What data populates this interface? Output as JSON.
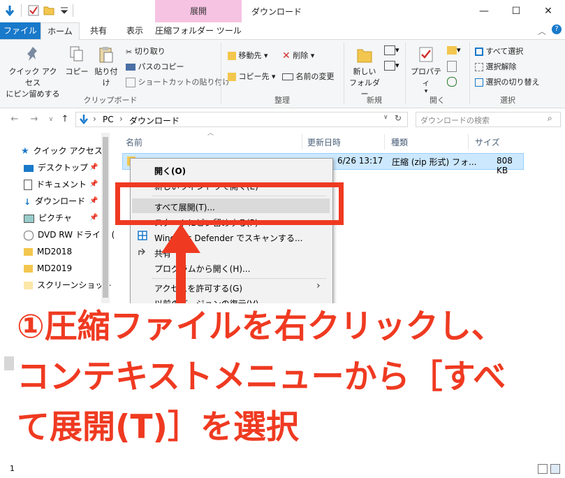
{
  "window": {
    "title": "ダウンロード",
    "context_tab_header": "展開",
    "minimize": "—",
    "maximize": "☐",
    "close": "✕"
  },
  "tabs": [
    "ファイル",
    "ホーム",
    "共有",
    "表示",
    "圧縮フォルダー ツール"
  ],
  "ribbon": {
    "clipboard": {
      "label": "クリップボード",
      "pin_quick_access_line1": "クイック アクセス",
      "pin_quick_access_line2": "にピン留めする",
      "copy": "コピー",
      "paste": "貼り付け",
      "cut": "切り取り",
      "copy_path": "パスのコピー",
      "paste_shortcut": "ショートカットの貼り付け"
    },
    "organize": {
      "label": "整理",
      "move_to": "移動先",
      "copy_to": "コピー先",
      "delete": "削除",
      "rename": "名前の変更"
    },
    "new": {
      "label": "新規",
      "new_folder_line1": "新しい",
      "new_folder_line2": "フォルダー"
    },
    "open": {
      "label": "開く",
      "properties": "プロパティ"
    },
    "select": {
      "label": "選択",
      "select_all": "すべて選択",
      "select_none": "選択解除",
      "invert": "選択の切り替え"
    }
  },
  "address": {
    "path_root": "PC",
    "path_folder": "ダウンロード",
    "search_placeholder": "ダウンロードの検索"
  },
  "nav_pane": {
    "quick_access": "クイック アクセス",
    "items": [
      "デスクトップ",
      "ドキュメント",
      "ダウンロード",
      "ピクチャ",
      "DVD RW ドライブ (",
      "MD2018",
      "MD2019",
      "スクリーンショット"
    ]
  },
  "columns": {
    "name": "名前",
    "modified": "更新日時",
    "type": "種類",
    "size": "サイズ"
  },
  "file": {
    "modified": "6/26 13:17",
    "type": "圧縮 (zip 形式) フォ...",
    "size": "808 KB"
  },
  "context_menu": {
    "open": "開く(O)",
    "open_new_window": "新しいウィンドウで開く(E)",
    "extract_all": "すべて展開(T)...",
    "pin_start": "スタートにピン留めする(P)",
    "defender": "Windows Defender でスキャンする...",
    "share": "共有",
    "open_with": "プログラムから開く(H)...",
    "give_access": "アクセスを許可する(G)",
    "restore_versions": "以前のバージョンの復元(V)"
  },
  "annotation": {
    "line1": "①圧縮ファイルを右クリックし、",
    "line2": "コンテキストメニューから［すべ",
    "line3": "て展開(T)］を選択"
  },
  "status": {
    "count": "1"
  },
  "colors": {
    "accent": "#1979ca",
    "context_tab": "#f6c3e2",
    "annotation_red": "#ef3a21",
    "selection": "#cce8ff"
  }
}
